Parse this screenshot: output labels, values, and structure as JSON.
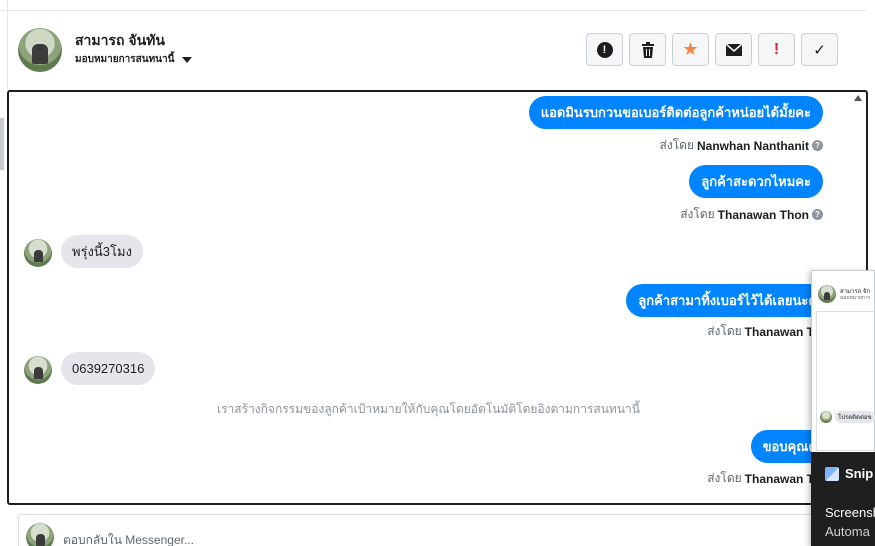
{
  "header": {
    "contact_name": "สามารถ จันทัน",
    "assign_label": "มอบหมายการสนทนานี้"
  },
  "toolbar": {
    "buttons": [
      {
        "name": "spam-button",
        "icon": "alert-circle-icon",
        "glyph": "!"
      },
      {
        "name": "delete-button",
        "icon": "trash-icon",
        "glyph": "🗑"
      },
      {
        "name": "star-button",
        "icon": "star-icon",
        "glyph": "★"
      },
      {
        "name": "mail-button",
        "icon": "envelope-icon",
        "glyph": "✉"
      },
      {
        "name": "mark-important-button",
        "icon": "exclamation-icon",
        "glyph": "!"
      },
      {
        "name": "done-button",
        "icon": "check-icon",
        "glyph": "✓"
      }
    ]
  },
  "messages": {
    "m1": {
      "text": "แอดมินรบกวนขอเบอร์ติดต่อลูกค้าหน่อยได้มั้ยคะ",
      "sent_by_prefix": "ส่งโดย",
      "sender": "Nanwhan Nanthanit"
    },
    "m2": {
      "text": "ลูกค้าสะดวกไหมคะ",
      "sent_by_prefix": "ส่งโดย",
      "sender": "Thanawan Thon"
    },
    "m3": {
      "text": "พรุ่งนี้3โมง"
    },
    "m4": {
      "text": "ลูกค้าสามาทิ้งเบอร์ไว้ได้เลยนะคะ",
      "sent_by_prefix": "ส่งโดย",
      "sender": "Thanawan Thon"
    },
    "m5": {
      "text": "0639270316"
    },
    "system_note": "เราสร้างกิจกรรมของลูกค้าเป้าหมายให้กับคุณโดยอัตโนมัติโดยอิงตามการสนทนานี้",
    "m6": {
      "text": "ขอบคุณค่ะ",
      "sent_by_prefix": "ส่งโดย",
      "sender": "Thanawan Thon"
    }
  },
  "reply": {
    "placeholder": "ตอบกลับใน Messenger..."
  },
  "popup": {
    "name": "สามารถ จัก",
    "sub": "มอบหมายการ",
    "msg": "โปรดติดต่อข"
  },
  "taskbar_preview": {
    "app_label": "Snip",
    "line1": "Screensh",
    "line2": "Automa"
  },
  "colors": {
    "accent": "#0084ff",
    "incoming_bubble": "#e4e6eb",
    "star": "#f5853f",
    "important": "#e41e3f"
  }
}
